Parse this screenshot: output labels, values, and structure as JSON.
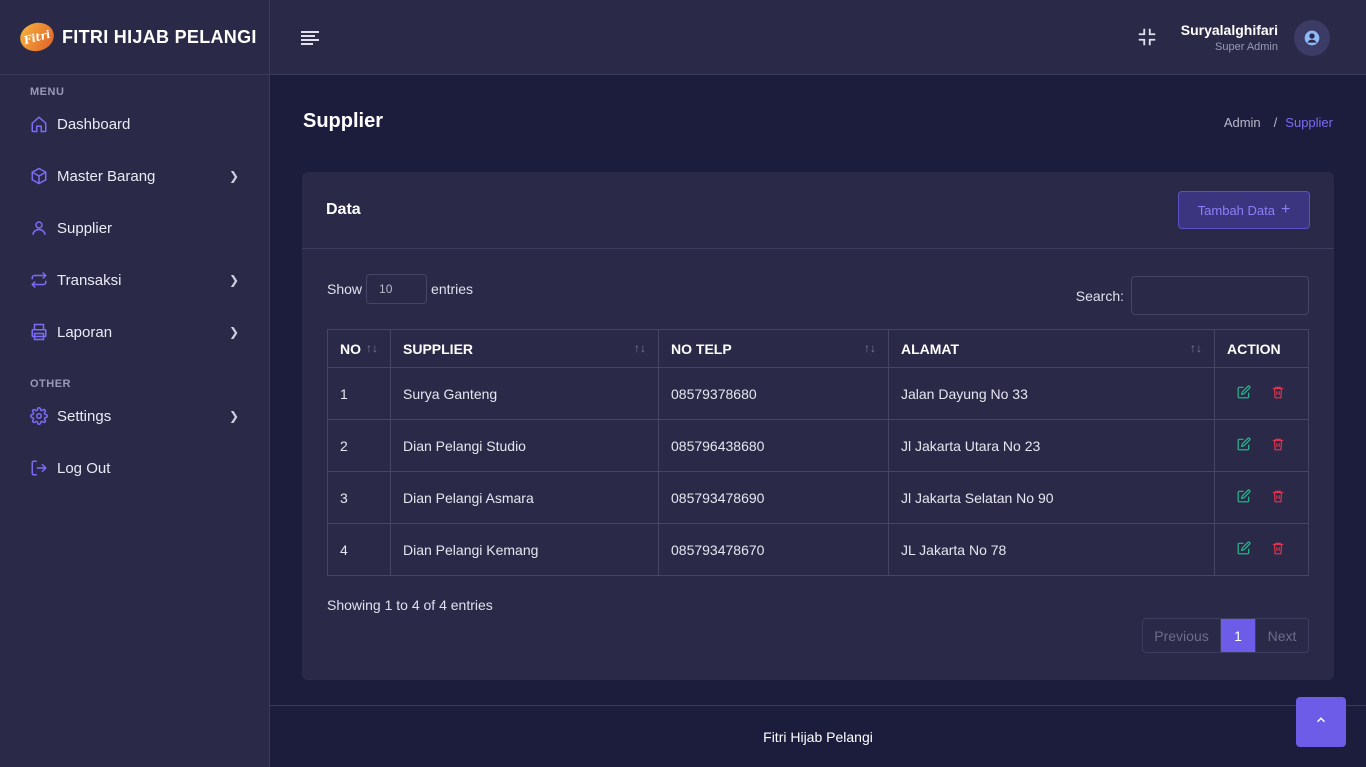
{
  "brand": {
    "name": "FITRI HIJAB PELANGI",
    "logo_text": "Fitri"
  },
  "sidebar": {
    "section_menu": "MENU",
    "section_other": "OTHER",
    "items": [
      {
        "label": "Dashboard",
        "icon": "home-icon"
      },
      {
        "label": "Master Barang",
        "icon": "box-icon"
      },
      {
        "label": "Supplier",
        "icon": "user-icon"
      },
      {
        "label": "Transaksi",
        "icon": "repeat-icon"
      },
      {
        "label": "Laporan",
        "icon": "printer-icon"
      },
      {
        "label": "Settings",
        "icon": "gear-icon"
      },
      {
        "label": "Log Out",
        "icon": "logout-icon"
      }
    ]
  },
  "header": {
    "user_name": "Suryalalghifari",
    "user_role": "Super Admin"
  },
  "page": {
    "title": "Supplier",
    "breadcrumb": {
      "root": "Admin",
      "sep": "/",
      "current": "Supplier"
    }
  },
  "card": {
    "title": "Data",
    "add_button": "Tambah Data",
    "show_label": "Show",
    "entries_value": "10",
    "entries_label": "entries",
    "search_label": "Search:",
    "search_value": ""
  },
  "table": {
    "headers": [
      "NO",
      "SUPPLIER",
      "NO TELP",
      "ALAMAT",
      "ACTION"
    ],
    "rows": [
      {
        "no": "1",
        "supplier": "Surya Ganteng",
        "telp": "08579378680",
        "alamat": "Jalan Dayung No 33"
      },
      {
        "no": "2",
        "supplier": "Dian Pelangi Studio",
        "telp": "085796438680",
        "alamat": "Jl Jakarta Utara No 23"
      },
      {
        "no": "3",
        "supplier": "Dian Pelangi Asmara",
        "telp": "085793478690",
        "alamat": "Jl Jakarta Selatan No 90"
      },
      {
        "no": "4",
        "supplier": "Dian Pelangi Kemang",
        "telp": "085793478670",
        "alamat": "JL Jakarta No 78"
      }
    ]
  },
  "pagination": {
    "info": "Showing 1 to 4 of 4 entries",
    "prev": "Previous",
    "current": "1",
    "next": "Next"
  },
  "footer": {
    "text": "Fitri Hijab Pelangi"
  },
  "colors": {
    "accent": "#6c5ce7",
    "edit": "#1fbf8f",
    "delete": "#e0344e",
    "sidebar_bg": "#2a2a48",
    "page_bg": "#1c1c3c"
  }
}
